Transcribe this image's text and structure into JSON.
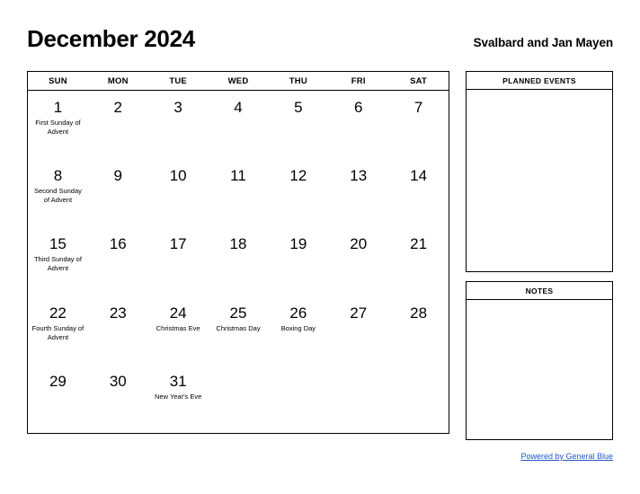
{
  "header": {
    "title": "December 2024",
    "region": "Svalbard and Jan Mayen"
  },
  "calendar": {
    "weekdays": [
      "SUN",
      "MON",
      "TUE",
      "WED",
      "THU",
      "FRI",
      "SAT"
    ],
    "weeks": [
      [
        {
          "day": "1",
          "event": "First Sunday of Advent"
        },
        {
          "day": "2",
          "event": ""
        },
        {
          "day": "3",
          "event": ""
        },
        {
          "day": "4",
          "event": ""
        },
        {
          "day": "5",
          "event": ""
        },
        {
          "day": "6",
          "event": ""
        },
        {
          "day": "7",
          "event": ""
        }
      ],
      [
        {
          "day": "8",
          "event": "Second Sunday of Advent"
        },
        {
          "day": "9",
          "event": ""
        },
        {
          "day": "10",
          "event": ""
        },
        {
          "day": "11",
          "event": ""
        },
        {
          "day": "12",
          "event": ""
        },
        {
          "day": "13",
          "event": ""
        },
        {
          "day": "14",
          "event": ""
        }
      ],
      [
        {
          "day": "15",
          "event": "Third Sunday of Advent"
        },
        {
          "day": "16",
          "event": ""
        },
        {
          "day": "17",
          "event": ""
        },
        {
          "day": "18",
          "event": ""
        },
        {
          "day": "19",
          "event": ""
        },
        {
          "day": "20",
          "event": ""
        },
        {
          "day": "21",
          "event": ""
        }
      ],
      [
        {
          "day": "22",
          "event": "Fourth Sunday of Advent"
        },
        {
          "day": "23",
          "event": ""
        },
        {
          "day": "24",
          "event": "Christmas Eve"
        },
        {
          "day": "25",
          "event": "Christmas Day"
        },
        {
          "day": "26",
          "event": "Boxing Day"
        },
        {
          "day": "27",
          "event": ""
        },
        {
          "day": "28",
          "event": ""
        }
      ],
      [
        {
          "day": "29",
          "event": ""
        },
        {
          "day": "30",
          "event": ""
        },
        {
          "day": "31",
          "event": "New Year's Eve"
        },
        {
          "day": "",
          "event": ""
        },
        {
          "day": "",
          "event": ""
        },
        {
          "day": "",
          "event": ""
        },
        {
          "day": "",
          "event": ""
        }
      ]
    ]
  },
  "sidebar": {
    "planned_events_title": "PLANNED EVENTS",
    "planned_events_body": "",
    "notes_title": "NOTES",
    "notes_body": ""
  },
  "footer": {
    "powered_by": "Powered by General Blue",
    "link_color": "#2255cc"
  }
}
